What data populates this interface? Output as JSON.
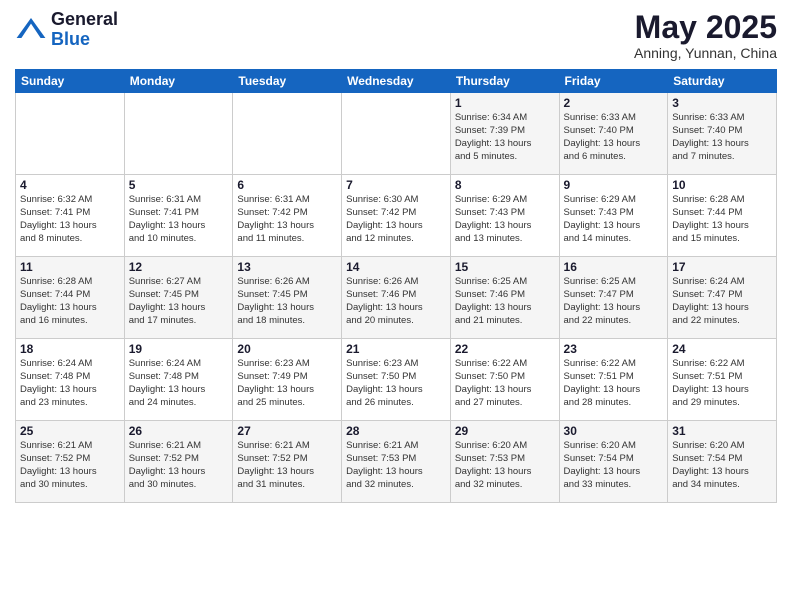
{
  "header": {
    "logo_general": "General",
    "logo_blue": "Blue",
    "month_title": "May 2025",
    "location": "Anning, Yunnan, China"
  },
  "weekdays": [
    "Sunday",
    "Monday",
    "Tuesday",
    "Wednesday",
    "Thursday",
    "Friday",
    "Saturday"
  ],
  "weeks": [
    [
      {
        "day": "",
        "info": ""
      },
      {
        "day": "",
        "info": ""
      },
      {
        "day": "",
        "info": ""
      },
      {
        "day": "",
        "info": ""
      },
      {
        "day": "1",
        "info": "Sunrise: 6:34 AM\nSunset: 7:39 PM\nDaylight: 13 hours\nand 5 minutes."
      },
      {
        "day": "2",
        "info": "Sunrise: 6:33 AM\nSunset: 7:40 PM\nDaylight: 13 hours\nand 6 minutes."
      },
      {
        "day": "3",
        "info": "Sunrise: 6:33 AM\nSunset: 7:40 PM\nDaylight: 13 hours\nand 7 minutes."
      }
    ],
    [
      {
        "day": "4",
        "info": "Sunrise: 6:32 AM\nSunset: 7:41 PM\nDaylight: 13 hours\nand 8 minutes."
      },
      {
        "day": "5",
        "info": "Sunrise: 6:31 AM\nSunset: 7:41 PM\nDaylight: 13 hours\nand 10 minutes."
      },
      {
        "day": "6",
        "info": "Sunrise: 6:31 AM\nSunset: 7:42 PM\nDaylight: 13 hours\nand 11 minutes."
      },
      {
        "day": "7",
        "info": "Sunrise: 6:30 AM\nSunset: 7:42 PM\nDaylight: 13 hours\nand 12 minutes."
      },
      {
        "day": "8",
        "info": "Sunrise: 6:29 AM\nSunset: 7:43 PM\nDaylight: 13 hours\nand 13 minutes."
      },
      {
        "day": "9",
        "info": "Sunrise: 6:29 AM\nSunset: 7:43 PM\nDaylight: 13 hours\nand 14 minutes."
      },
      {
        "day": "10",
        "info": "Sunrise: 6:28 AM\nSunset: 7:44 PM\nDaylight: 13 hours\nand 15 minutes."
      }
    ],
    [
      {
        "day": "11",
        "info": "Sunrise: 6:28 AM\nSunset: 7:44 PM\nDaylight: 13 hours\nand 16 minutes."
      },
      {
        "day": "12",
        "info": "Sunrise: 6:27 AM\nSunset: 7:45 PM\nDaylight: 13 hours\nand 17 minutes."
      },
      {
        "day": "13",
        "info": "Sunrise: 6:26 AM\nSunset: 7:45 PM\nDaylight: 13 hours\nand 18 minutes."
      },
      {
        "day": "14",
        "info": "Sunrise: 6:26 AM\nSunset: 7:46 PM\nDaylight: 13 hours\nand 20 minutes."
      },
      {
        "day": "15",
        "info": "Sunrise: 6:25 AM\nSunset: 7:46 PM\nDaylight: 13 hours\nand 21 minutes."
      },
      {
        "day": "16",
        "info": "Sunrise: 6:25 AM\nSunset: 7:47 PM\nDaylight: 13 hours\nand 22 minutes."
      },
      {
        "day": "17",
        "info": "Sunrise: 6:24 AM\nSunset: 7:47 PM\nDaylight: 13 hours\nand 22 minutes."
      }
    ],
    [
      {
        "day": "18",
        "info": "Sunrise: 6:24 AM\nSunset: 7:48 PM\nDaylight: 13 hours\nand 23 minutes."
      },
      {
        "day": "19",
        "info": "Sunrise: 6:24 AM\nSunset: 7:48 PM\nDaylight: 13 hours\nand 24 minutes."
      },
      {
        "day": "20",
        "info": "Sunrise: 6:23 AM\nSunset: 7:49 PM\nDaylight: 13 hours\nand 25 minutes."
      },
      {
        "day": "21",
        "info": "Sunrise: 6:23 AM\nSunset: 7:50 PM\nDaylight: 13 hours\nand 26 minutes."
      },
      {
        "day": "22",
        "info": "Sunrise: 6:22 AM\nSunset: 7:50 PM\nDaylight: 13 hours\nand 27 minutes."
      },
      {
        "day": "23",
        "info": "Sunrise: 6:22 AM\nSunset: 7:51 PM\nDaylight: 13 hours\nand 28 minutes."
      },
      {
        "day": "24",
        "info": "Sunrise: 6:22 AM\nSunset: 7:51 PM\nDaylight: 13 hours\nand 29 minutes."
      }
    ],
    [
      {
        "day": "25",
        "info": "Sunrise: 6:21 AM\nSunset: 7:52 PM\nDaylight: 13 hours\nand 30 minutes."
      },
      {
        "day": "26",
        "info": "Sunrise: 6:21 AM\nSunset: 7:52 PM\nDaylight: 13 hours\nand 30 minutes."
      },
      {
        "day": "27",
        "info": "Sunrise: 6:21 AM\nSunset: 7:52 PM\nDaylight: 13 hours\nand 31 minutes."
      },
      {
        "day": "28",
        "info": "Sunrise: 6:21 AM\nSunset: 7:53 PM\nDaylight: 13 hours\nand 32 minutes."
      },
      {
        "day": "29",
        "info": "Sunrise: 6:20 AM\nSunset: 7:53 PM\nDaylight: 13 hours\nand 32 minutes."
      },
      {
        "day": "30",
        "info": "Sunrise: 6:20 AM\nSunset: 7:54 PM\nDaylight: 13 hours\nand 33 minutes."
      },
      {
        "day": "31",
        "info": "Sunrise: 6:20 AM\nSunset: 7:54 PM\nDaylight: 13 hours\nand 34 minutes."
      }
    ]
  ]
}
